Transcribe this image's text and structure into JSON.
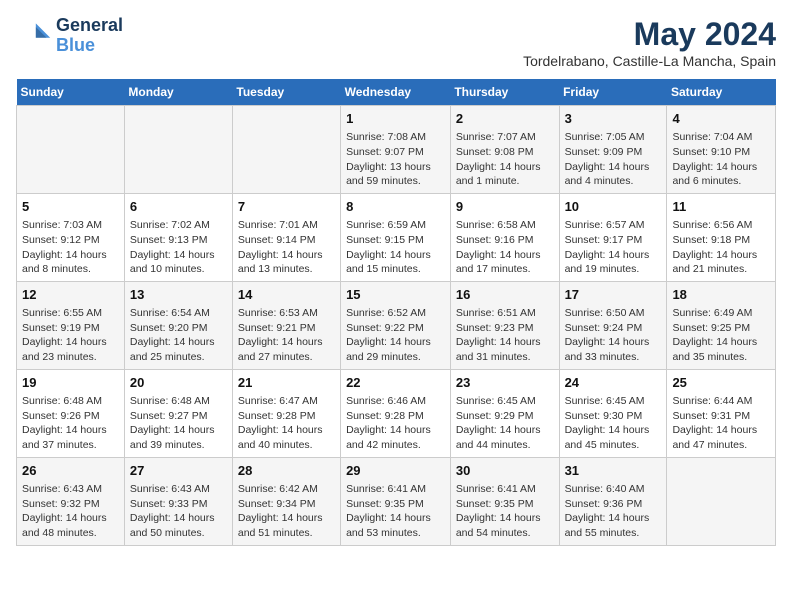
{
  "header": {
    "logo_line1": "General",
    "logo_line2": "Blue",
    "month": "May 2024",
    "location": "Tordelrabano, Castille-La Mancha, Spain"
  },
  "days_of_week": [
    "Sunday",
    "Monday",
    "Tuesday",
    "Wednesday",
    "Thursday",
    "Friday",
    "Saturday"
  ],
  "weeks": [
    [
      {
        "day": "",
        "info": ""
      },
      {
        "day": "",
        "info": ""
      },
      {
        "day": "",
        "info": ""
      },
      {
        "day": "1",
        "info": "Sunrise: 7:08 AM\nSunset: 9:07 PM\nDaylight: 13 hours and 59 minutes."
      },
      {
        "day": "2",
        "info": "Sunrise: 7:07 AM\nSunset: 9:08 PM\nDaylight: 14 hours and 1 minute."
      },
      {
        "day": "3",
        "info": "Sunrise: 7:05 AM\nSunset: 9:09 PM\nDaylight: 14 hours and 4 minutes."
      },
      {
        "day": "4",
        "info": "Sunrise: 7:04 AM\nSunset: 9:10 PM\nDaylight: 14 hours and 6 minutes."
      }
    ],
    [
      {
        "day": "5",
        "info": "Sunrise: 7:03 AM\nSunset: 9:12 PM\nDaylight: 14 hours and 8 minutes."
      },
      {
        "day": "6",
        "info": "Sunrise: 7:02 AM\nSunset: 9:13 PM\nDaylight: 14 hours and 10 minutes."
      },
      {
        "day": "7",
        "info": "Sunrise: 7:01 AM\nSunset: 9:14 PM\nDaylight: 14 hours and 13 minutes."
      },
      {
        "day": "8",
        "info": "Sunrise: 6:59 AM\nSunset: 9:15 PM\nDaylight: 14 hours and 15 minutes."
      },
      {
        "day": "9",
        "info": "Sunrise: 6:58 AM\nSunset: 9:16 PM\nDaylight: 14 hours and 17 minutes."
      },
      {
        "day": "10",
        "info": "Sunrise: 6:57 AM\nSunset: 9:17 PM\nDaylight: 14 hours and 19 minutes."
      },
      {
        "day": "11",
        "info": "Sunrise: 6:56 AM\nSunset: 9:18 PM\nDaylight: 14 hours and 21 minutes."
      }
    ],
    [
      {
        "day": "12",
        "info": "Sunrise: 6:55 AM\nSunset: 9:19 PM\nDaylight: 14 hours and 23 minutes."
      },
      {
        "day": "13",
        "info": "Sunrise: 6:54 AM\nSunset: 9:20 PM\nDaylight: 14 hours and 25 minutes."
      },
      {
        "day": "14",
        "info": "Sunrise: 6:53 AM\nSunset: 9:21 PM\nDaylight: 14 hours and 27 minutes."
      },
      {
        "day": "15",
        "info": "Sunrise: 6:52 AM\nSunset: 9:22 PM\nDaylight: 14 hours and 29 minutes."
      },
      {
        "day": "16",
        "info": "Sunrise: 6:51 AM\nSunset: 9:23 PM\nDaylight: 14 hours and 31 minutes."
      },
      {
        "day": "17",
        "info": "Sunrise: 6:50 AM\nSunset: 9:24 PM\nDaylight: 14 hours and 33 minutes."
      },
      {
        "day": "18",
        "info": "Sunrise: 6:49 AM\nSunset: 9:25 PM\nDaylight: 14 hours and 35 minutes."
      }
    ],
    [
      {
        "day": "19",
        "info": "Sunrise: 6:48 AM\nSunset: 9:26 PM\nDaylight: 14 hours and 37 minutes."
      },
      {
        "day": "20",
        "info": "Sunrise: 6:48 AM\nSunset: 9:27 PM\nDaylight: 14 hours and 39 minutes."
      },
      {
        "day": "21",
        "info": "Sunrise: 6:47 AM\nSunset: 9:28 PM\nDaylight: 14 hours and 40 minutes."
      },
      {
        "day": "22",
        "info": "Sunrise: 6:46 AM\nSunset: 9:28 PM\nDaylight: 14 hours and 42 minutes."
      },
      {
        "day": "23",
        "info": "Sunrise: 6:45 AM\nSunset: 9:29 PM\nDaylight: 14 hours and 44 minutes."
      },
      {
        "day": "24",
        "info": "Sunrise: 6:45 AM\nSunset: 9:30 PM\nDaylight: 14 hours and 45 minutes."
      },
      {
        "day": "25",
        "info": "Sunrise: 6:44 AM\nSunset: 9:31 PM\nDaylight: 14 hours and 47 minutes."
      }
    ],
    [
      {
        "day": "26",
        "info": "Sunrise: 6:43 AM\nSunset: 9:32 PM\nDaylight: 14 hours and 48 minutes."
      },
      {
        "day": "27",
        "info": "Sunrise: 6:43 AM\nSunset: 9:33 PM\nDaylight: 14 hours and 50 minutes."
      },
      {
        "day": "28",
        "info": "Sunrise: 6:42 AM\nSunset: 9:34 PM\nDaylight: 14 hours and 51 minutes."
      },
      {
        "day": "29",
        "info": "Sunrise: 6:41 AM\nSunset: 9:35 PM\nDaylight: 14 hours and 53 minutes."
      },
      {
        "day": "30",
        "info": "Sunrise: 6:41 AM\nSunset: 9:35 PM\nDaylight: 14 hours and 54 minutes."
      },
      {
        "day": "31",
        "info": "Sunrise: 6:40 AM\nSunset: 9:36 PM\nDaylight: 14 hours and 55 minutes."
      },
      {
        "day": "",
        "info": ""
      }
    ]
  ]
}
